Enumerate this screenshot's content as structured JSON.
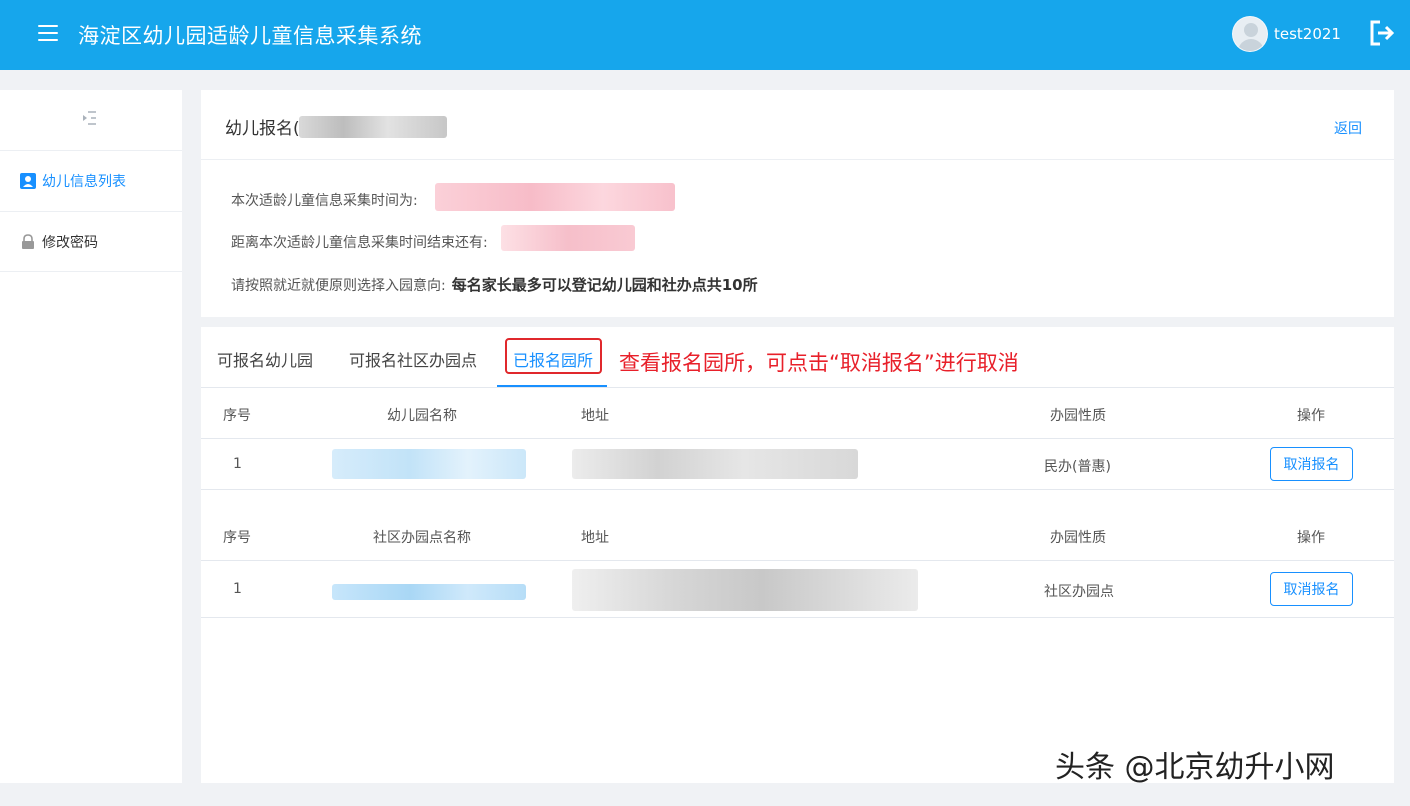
{
  "header": {
    "title": "海淀区幼儿园适龄儿童信息采集系统",
    "username": "test2021"
  },
  "sidebar": {
    "items": [
      {
        "label": "幼儿信息列表",
        "icon": "user-icon",
        "active": true
      },
      {
        "label": "修改密码",
        "icon": "lock-icon",
        "active": false
      }
    ]
  },
  "info": {
    "title": "幼儿报名(",
    "back_label": "返回",
    "line1": "本次适龄儿童信息采集时间为:",
    "line2": "距离本次适龄儿童信息采集时间结束还有:",
    "line3": "请按照就近就便原则选择入园意向:",
    "line3_bold": "每名家长最多可以登记幼儿园和社办点共10所"
  },
  "tabs": {
    "items": [
      "可报名幼儿园",
      "可报名社区办园点",
      "已报名园所"
    ],
    "active_index": 2,
    "annotation": "查看报名园所，可点击“取消报名”进行取消"
  },
  "table1": {
    "headers": [
      "序号",
      "幼儿园名称",
      "地址",
      "办园性质",
      "操作"
    ],
    "rows": [
      {
        "index": "1",
        "nature": "民办(普惠)",
        "action": "取消报名"
      }
    ]
  },
  "table2": {
    "headers": [
      "序号",
      "社区办园点名称",
      "地址",
      "办园性质",
      "操作"
    ],
    "rows": [
      {
        "index": "1",
        "nature": "社区办园点",
        "action": "取消报名"
      }
    ]
  },
  "watermark": "头条 @北京幼升小网",
  "colors": {
    "accent": "#16a6ec",
    "link": "#1890ff",
    "annotation": "#e8202a"
  }
}
